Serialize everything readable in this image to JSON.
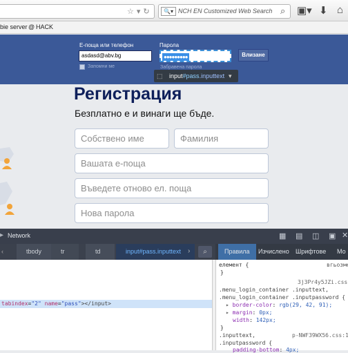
{
  "browser": {
    "search_placeholder": "NCH EN Customized Web Search",
    "search_engine_icon": "magnifier-box-icon",
    "bookmarks": [
      {
        "label": "bie server"
      },
      {
        "label": "HACK",
        "icon": "@"
      }
    ]
  },
  "facebook": {
    "email_label": "Е-поща или телефон",
    "email_value": "asdasd@abv.bg",
    "password_label": "Парола",
    "password_dots": "●●●●●●●●●",
    "remember_label": "Запомни ме",
    "forgot_label": "Забравена парола",
    "login_label": "Влизане",
    "tooltip_tag": "input",
    "tooltip_id": "#pass",
    "tooltip_class": ".inputtext",
    "heading": "Регистрация",
    "subheading": "Безплатно е и винаги ще бъде.",
    "first_name": "Собствено име",
    "last_name": "Фамилия",
    "email_placeholder": "Вашата е-поща",
    "email_confirm": "Въведете отново ел. поща",
    "new_password": "Нова парола"
  },
  "devtools": {
    "network_tab": "Network",
    "crumbs": [
      "tbody",
      "tr",
      "td",
      "input#pass.inputtext"
    ],
    "rule_tabs": [
      "Правила",
      "Изчислено",
      "Шрифтове",
      "Мо"
    ],
    "markup": {
      "attr1_name": "tabindex",
      "attr1_value": "\"2\"",
      "attr2_name": "name",
      "attr2_value": "\"pass\"",
      "close_tag": "></input>"
    },
    "css": {
      "element_line": "елемент {",
      "element_source": "вгьозмен",
      "source1": "3j3Pr4y5JZi.css:1",
      "selector1a": ".menu_login_container .inputtext,",
      "selector1b": ".menu_login_container .inputpassword {",
      "prop1_name": "border-color",
      "prop1_value": "rgb(29, 42, 91);",
      "prop2_name": "margin",
      "prop2_value": "0px;",
      "prop3_name": "width",
      "prop3_value": "142px;",
      "selector2a": ".inputtext,",
      "source2": "p-NWF39WX56.css:1",
      "selector2b": ".inputpassword {",
      "prop4_name": "padding-bottom",
      "prop4_value": "4px;"
    }
  },
  "colors": {
    "fb_blue": "#3b5998",
    "heading": "#0e1f5a",
    "devtools_dark": "#393f4c",
    "css_selector": "#444",
    "css_property": "#8b2cb0",
    "css_value": "#2e5fb7"
  }
}
